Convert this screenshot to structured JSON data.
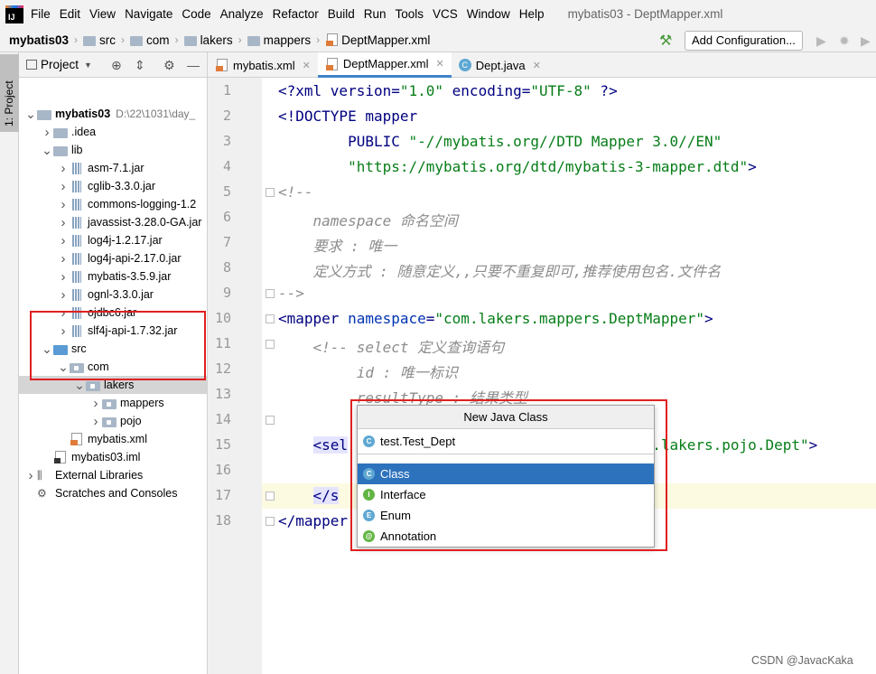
{
  "menubar": {
    "logo": "IJ",
    "items": [
      "File",
      "Edit",
      "View",
      "Navigate",
      "Code",
      "Analyze",
      "Refactor",
      "Build",
      "Run",
      "Tools",
      "VCS",
      "Window",
      "Help"
    ],
    "window_title": "mybatis03 - DeptMapper.xml"
  },
  "navbar": {
    "breadcrumbs": [
      "mybatis03",
      "src",
      "com",
      "lakers",
      "mappers",
      "DeptMapper.xml"
    ],
    "add_config": "Add Configuration..."
  },
  "side_strip": {
    "tab": "1: Project"
  },
  "project_panel": {
    "title": "Project",
    "tree": [
      {
        "label": "mybatis03",
        "hint": "D:\\22\\1031\\day_",
        "level": 0,
        "arrow": "v",
        "icon": "folder",
        "bold": true
      },
      {
        "label": ".idea",
        "level": 1,
        "arrow": ">",
        "icon": "folder"
      },
      {
        "label": "lib",
        "level": 1,
        "arrow": "v",
        "icon": "folder"
      },
      {
        "label": "asm-7.1.jar",
        "level": 2,
        "arrow": ">",
        "icon": "jar"
      },
      {
        "label": "cglib-3.3.0.jar",
        "level": 2,
        "arrow": ">",
        "icon": "jar"
      },
      {
        "label": "commons-logging-1.2",
        "level": 2,
        "arrow": ">",
        "icon": "jar"
      },
      {
        "label": "javassist-3.28.0-GA.jar",
        "level": 2,
        "arrow": ">",
        "icon": "jar"
      },
      {
        "label": "log4j-1.2.17.jar",
        "level": 2,
        "arrow": ">",
        "icon": "jar"
      },
      {
        "label": "log4j-api-2.17.0.jar",
        "level": 2,
        "arrow": ">",
        "icon": "jar"
      },
      {
        "label": "mybatis-3.5.9.jar",
        "level": 2,
        "arrow": ">",
        "icon": "jar"
      },
      {
        "label": "ognl-3.3.0.jar",
        "level": 2,
        "arrow": ">",
        "icon": "jar"
      },
      {
        "label": "ojdbc6.jar",
        "level": 2,
        "arrow": ">",
        "icon": "jar"
      },
      {
        "label": "slf4j-api-1.7.32.jar",
        "level": 2,
        "arrow": ">",
        "icon": "jar"
      },
      {
        "label": "src",
        "level": 1,
        "arrow": "v",
        "icon": "src"
      },
      {
        "label": "com",
        "level": 2,
        "arrow": "v",
        "icon": "pkg"
      },
      {
        "label": "lakers",
        "level": 3,
        "arrow": "v",
        "icon": "pkg",
        "selected": true
      },
      {
        "label": "mappers",
        "level": 4,
        "arrow": ">",
        "icon": "pkg"
      },
      {
        "label": "pojo",
        "level": 4,
        "arrow": ">",
        "icon": "pkg"
      },
      {
        "label": "mybatis.xml",
        "level": 2,
        "arrow": "",
        "icon": "xml"
      },
      {
        "label": "mybatis03.iml",
        "level": 1,
        "arrow": "",
        "icon": "iml"
      },
      {
        "label": "External Libraries",
        "level": 0,
        "arrow": ">",
        "icon": "lib"
      },
      {
        "label": "Scratches and Consoles",
        "level": 0,
        "arrow": "",
        "icon": "scratch"
      }
    ]
  },
  "tabs": [
    {
      "label": "mybatis.xml",
      "icon": "xml",
      "active": false
    },
    {
      "label": "DeptMapper.xml",
      "icon": "xml",
      "active": true
    },
    {
      "label": "Dept.java",
      "icon": "class",
      "active": false
    }
  ],
  "editor": {
    "line_numbers": [
      "1",
      "2",
      "3",
      "4",
      "5",
      "6",
      "7",
      "8",
      "9",
      "10",
      "11",
      "12",
      "13",
      "14",
      "15",
      "16",
      "17",
      "18"
    ],
    "current_line": 17,
    "lines": [
      [
        {
          "t": "<?xml version=",
          "c": "tag"
        },
        {
          "t": "\"1.0\"",
          "c": "str"
        },
        {
          "t": " encoding=",
          "c": "tag"
        },
        {
          "t": "\"UTF-8\"",
          "c": "str"
        },
        {
          "t": " ?>",
          "c": "tag"
        }
      ],
      [
        {
          "t": "<!DOCTYPE mapper",
          "c": "tag"
        }
      ],
      [
        {
          "t": "        PUBLIC ",
          "c": "tag"
        },
        {
          "t": "\"-//mybatis.org//DTD Mapper 3.0//EN\"",
          "c": "str"
        }
      ],
      [
        {
          "t": "        ",
          "c": "tag"
        },
        {
          "t": "\"https://mybatis.org/dtd/mybatis-3-mapper.dtd\"",
          "c": "str"
        },
        {
          "t": ">",
          "c": "tag"
        }
      ],
      [
        {
          "t": "<!--",
          "c": "cmt"
        }
      ],
      [
        {
          "t": "    namespace 命名空间",
          "c": "cmt"
        }
      ],
      [
        {
          "t": "    要求 : 唯一",
          "c": "cmt"
        }
      ],
      [
        {
          "t": "    定义方式 : 随意定义,,只要不重复即可,推荐使用包名.文件名",
          "c": "cmt"
        }
      ],
      [
        {
          "t": "-->",
          "c": "cmt"
        }
      ],
      [
        {
          "t": "<mapper ",
          "c": "tag"
        },
        {
          "t": "namespace",
          "c": "kw"
        },
        {
          "t": "=",
          "c": "tag"
        },
        {
          "t": "\"com.lakers.mappers.DeptMapper\"",
          "c": "str"
        },
        {
          "t": ">",
          "c": "tag"
        }
      ],
      [
        {
          "t": "    <!-- select 定义查询语句",
          "c": "cmt"
        }
      ],
      [
        {
          "t": "         id : 唯一标识",
          "c": "cmt"
        }
      ],
      [
        {
          "t": "         resultType : 结果类型",
          "c": "cmt"
        }
      ],
      [
        {
          "t": "",
          "c": "tag"
        }
      ],
      [
        {
          "t": "    ",
          "c": "tag"
        },
        {
          "t": "<sel",
          "c": "taghl"
        },
        {
          "t": "                               ",
          "c": "tag"
        },
        {
          "t": "\"com.lakers.pojo.Dept\"",
          "c": "str"
        },
        {
          "t": ">",
          "c": "tag"
        }
      ],
      [
        {
          "t": "",
          "c": "tag"
        }
      ],
      [
        {
          "t": "    ",
          "c": "tag"
        },
        {
          "t": "</s",
          "c": "taghl"
        }
      ],
      [
        {
          "t": "</mapper",
          "c": "tag"
        }
      ]
    ]
  },
  "popup": {
    "title": "New Java Class",
    "input_value": "test.Test_Dept",
    "items": [
      {
        "label": "Class",
        "letter": "C",
        "color": "#5fa8d3",
        "selected": true
      },
      {
        "label": "Interface",
        "letter": "I",
        "color": "#62b543",
        "selected": false
      },
      {
        "label": "Enum",
        "letter": "E",
        "color": "#5fa8d3",
        "selected": false
      },
      {
        "label": "Annotation",
        "letter": "@",
        "color": "#62b543",
        "selected": false
      }
    ]
  },
  "watermark": "CSDN @JavacKaka"
}
